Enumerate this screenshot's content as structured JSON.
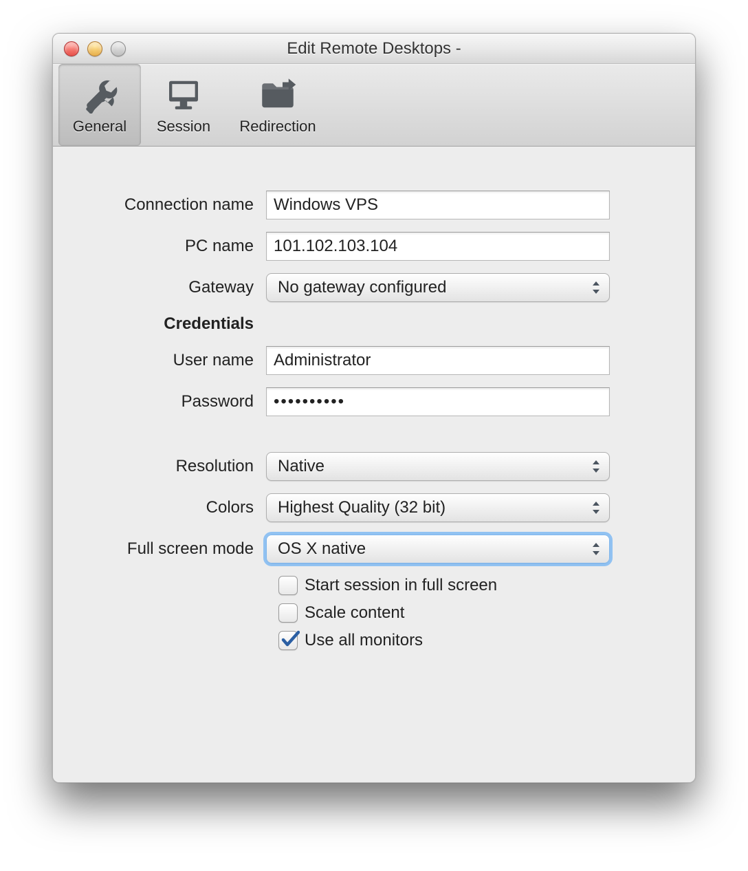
{
  "window": {
    "title": "Edit Remote Desktops -"
  },
  "toolbar": {
    "general": "General",
    "session": "Session",
    "redirection": "Redirection"
  },
  "form": {
    "connection_name_label": "Connection name",
    "connection_name_value": "Windows VPS",
    "pc_name_label": "PC name",
    "pc_name_value": "101.102.103.104",
    "gateway_label": "Gateway",
    "gateway_value": "No gateway configured",
    "credentials_heading": "Credentials",
    "username_label": "User name",
    "username_value": "Administrator",
    "password_label": "Password",
    "password_value": "••••••••••",
    "resolution_label": "Resolution",
    "resolution_value": "Native",
    "colors_label": "Colors",
    "colors_value": "Highest Quality (32 bit)",
    "fullscreen_mode_label": "Full screen mode",
    "fullscreen_mode_value": "OS X native",
    "start_fullscreen_label": "Start session in full screen",
    "scale_content_label": "Scale content",
    "use_all_monitors_label": "Use all monitors"
  }
}
